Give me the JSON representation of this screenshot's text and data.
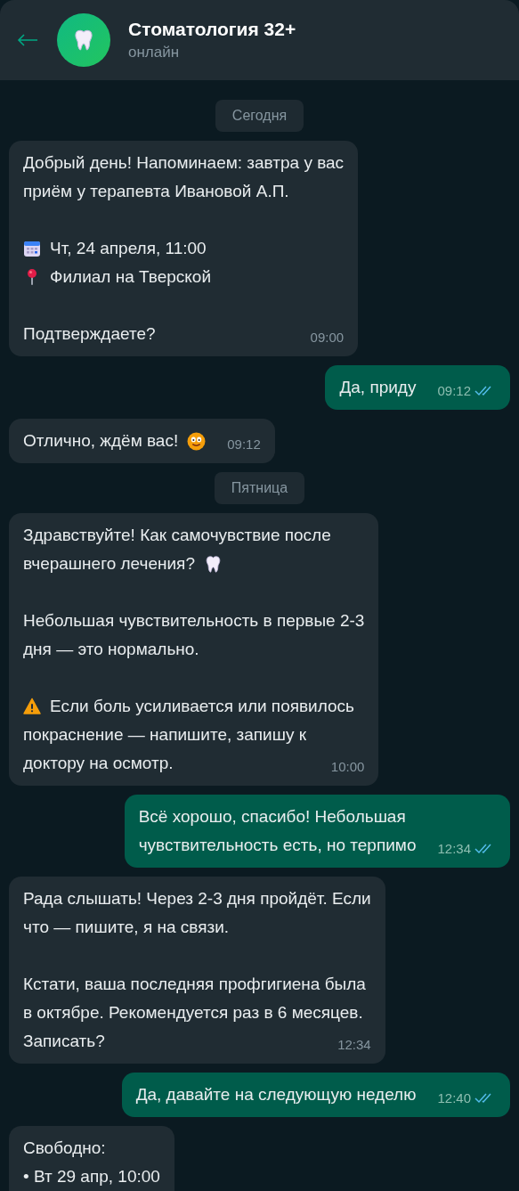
{
  "header": {
    "title": "Стоматология 32+",
    "status": "онлайн"
  },
  "messages": [
    {
      "kind": "date",
      "text": "Сегодня"
    },
    {
      "kind": "in",
      "paragraphs": [
        {
          "lines": [
            {
              "kind": "plain",
              "text": "Добрый день! Напоминаем: завтра у вас"
            },
            {
              "kind": "plain",
              "text": "приём у терапевта Ивановой А.П."
            }
          ]
        },
        {
          "lines": [
            {
              "kind": "calendar",
              "text": "Чт, 24 апреля, 11:00"
            },
            {
              "kind": "pin",
              "text": "Филиал на Тверской"
            }
          ]
        },
        {
          "lines": [
            {
              "kind": "plain",
              "text": "Подтверждаете?"
            }
          ]
        }
      ],
      "time": "09:00"
    },
    {
      "kind": "out",
      "paragraphs": [
        {
          "lines": [
            {
              "kind": "plain",
              "text": "Да, приду"
            }
          ]
        }
      ],
      "time": "09:12",
      "read": true
    },
    {
      "kind": "in",
      "paragraphs": [
        {
          "lines": [
            {
              "kind": "smile",
              "text": "Отлично, ждём вас!"
            }
          ]
        }
      ],
      "time": "09:12"
    },
    {
      "kind": "date",
      "text": "Пятница"
    },
    {
      "kind": "in",
      "paragraphs": [
        {
          "lines": [
            {
              "kind": "plain",
              "text": "Здравствуйте! Как самочувствие после"
            },
            {
              "kind": "tooth",
              "text": "вчерашнего лечения?"
            }
          ]
        },
        {
          "lines": [
            {
              "kind": "plain",
              "text": "Небольшая чувствительность в первые 2-3"
            },
            {
              "kind": "plain",
              "text": "дня — это нормально."
            }
          ]
        },
        {
          "lines": [
            {
              "kind": "warning",
              "text": "Если боль усиливается или появилось"
            },
            {
              "kind": "plain",
              "text": "покраснение — напишите, запишу к"
            },
            {
              "kind": "plain",
              "text": "доктору на осмотр."
            }
          ]
        }
      ],
      "time": "10:00"
    },
    {
      "kind": "out",
      "paragraphs": [
        {
          "lines": [
            {
              "kind": "plain",
              "text": "Всё хорошо, спасибо! Небольшая"
            },
            {
              "kind": "plain",
              "text": "чувствительность есть, но терпимо"
            }
          ]
        }
      ],
      "time": "12:34",
      "read": true
    },
    {
      "kind": "in",
      "paragraphs": [
        {
          "lines": [
            {
              "kind": "plain",
              "text": "Рада слышать! Через 2-3 дня пройдёт. Если"
            },
            {
              "kind": "plain",
              "text": "что — пишите, я на связи."
            }
          ]
        },
        {
          "lines": [
            {
              "kind": "plain",
              "text": "Кстати, ваша последняя профгигиена была"
            },
            {
              "kind": "plain",
              "text": "в октябре. Рекомендуется раз в 6 месяцев."
            },
            {
              "kind": "plain",
              "text": "Записать?"
            }
          ]
        }
      ],
      "time": "12:34"
    },
    {
      "kind": "out",
      "paragraphs": [
        {
          "lines": [
            {
              "kind": "plain",
              "text": "Да, давайте на следующую неделю"
            }
          ]
        }
      ],
      "time": "12:40",
      "read": true
    },
    {
      "kind": "in",
      "paragraphs": [
        {
          "lines": [
            {
              "kind": "plain",
              "text": "Свободно:"
            },
            {
              "kind": "plain",
              "text": "• Вт 29 апр, 10:00"
            }
          ]
        }
      ]
    }
  ]
}
